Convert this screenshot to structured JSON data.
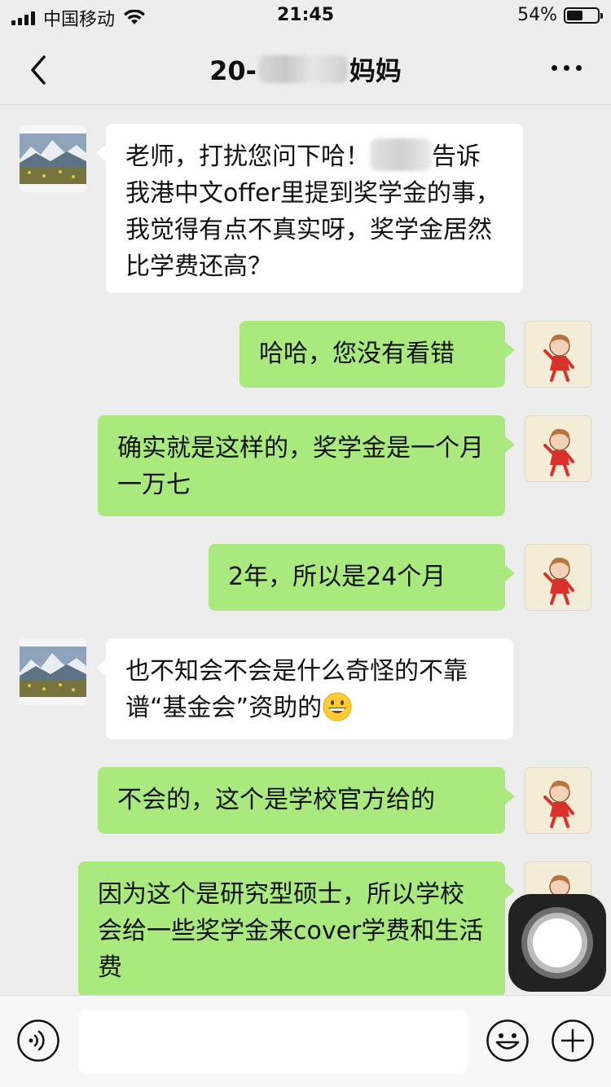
{
  "status_bar": {
    "carrier": "中国移动",
    "time": "21:45",
    "battery_text": "54%",
    "battery_level": 0.54
  },
  "nav": {
    "title_prefix": "20-",
    "title_suffix": "妈妈"
  },
  "messages": [
    {
      "side": "left",
      "avatar": "landscape-avatar",
      "text_a": "老师，打扰您问下哈！",
      "text_b": "告诉我港中文offer里提到奖学金的事，我觉得有点不真实呀，奖学金居然比学费还高？"
    },
    {
      "side": "right",
      "avatar": "girl-avatar",
      "text": "哈哈，您没有看错"
    },
    {
      "side": "right",
      "avatar": "girl-avatar",
      "text": "确实就是这样的，奖学金是一个月一万七"
    },
    {
      "side": "right",
      "avatar": "girl-avatar",
      "text": "2年，所以是24个月"
    },
    {
      "side": "left",
      "avatar": "landscape-avatar",
      "text": "也不知会不会是什么奇怪的不靠谱“基金会”资助的",
      "emoji": "grinning-face-emoji"
    },
    {
      "side": "right",
      "avatar": "girl-avatar",
      "text": "不会的，这个是学校官方给的"
    },
    {
      "side": "right",
      "avatar": "girl-avatar",
      "text": "因为这个是研究型硕士，所以学校会给一些奖学金来cover学费和生活费"
    }
  ],
  "input_bar": {
    "placeholder": "",
    "icons": [
      "voice-icon",
      "emoji-icon",
      "plus-icon"
    ]
  },
  "colors": {
    "background": "#ededed",
    "bubble_self": "#a9e97d",
    "bubble_other": "#ffffff"
  }
}
